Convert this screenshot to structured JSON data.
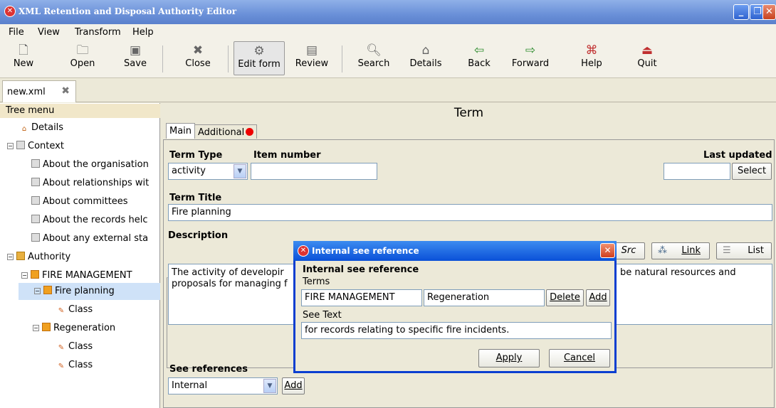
{
  "window": {
    "title": "XML Retention and Disposal Authority Editor"
  },
  "menu": [
    "File",
    "View",
    "Transform",
    "Help"
  ],
  "toolbar": {
    "new": "New",
    "open": "Open",
    "save": "Save",
    "close": "Close",
    "edit_form": "Edit form",
    "review": "Review",
    "search": "Search",
    "details": "Details",
    "back": "Back",
    "forward": "Forward",
    "help": "Help",
    "quit": "Quit"
  },
  "doc_tab": "new.xml",
  "tree": {
    "header": "Tree menu",
    "nodes": [
      "Details",
      "Context",
      "About the organisation",
      "About relationships wit",
      "About committees",
      "About the records helc",
      "About any external sta",
      "Authority",
      "FIRE MANAGEMENT",
      "Fire planning",
      "Class",
      "Regeneration",
      "Class",
      "Class"
    ]
  },
  "main": {
    "heading": "Term",
    "tab_main": "Main",
    "tab_additional": "Additional",
    "term_type_label": "Term Type",
    "term_type_value": "activity",
    "item_number_label": "Item number",
    "item_number_value": "",
    "last_updated_label": "Last updated",
    "last_updated_value": "",
    "select_button": "Select",
    "term_title_label": "Term Title",
    "term_title_value": "Fire planning",
    "description_label": "Description",
    "desc_toolbar_src": "Src",
    "desc_toolbar_link": "Link",
    "desc_toolbar_list": "List",
    "description_left": "The activity of developir",
    "description_left2": "proposals for managing f",
    "description_right": "be natural resources and",
    "see_refs_label": "See references",
    "see_refs_type": "Internal",
    "add_button": "Add"
  },
  "dialog": {
    "title": "Internal see reference",
    "heading": "Internal see reference",
    "terms_label": "Terms",
    "term1": "FIRE MANAGEMENT",
    "term2": "Regeneration",
    "delete_button": "Delete",
    "add_button": "Add",
    "see_text_label": "See Text",
    "see_text_value": "for records relating to specific fire incidents.",
    "apply_button": "Apply",
    "cancel_button": "Cancel"
  }
}
